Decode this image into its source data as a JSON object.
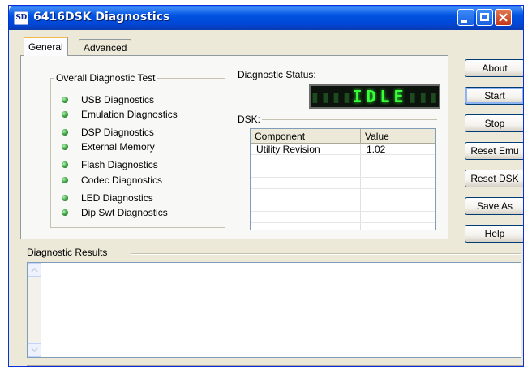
{
  "window": {
    "title": "6416DSK Diagnostics",
    "icon_text": "SD"
  },
  "tabs": [
    {
      "label": "General",
      "selected": true
    },
    {
      "label": "Advanced",
      "selected": false
    }
  ],
  "overall_test": {
    "label": "Overall Diagnostic Test",
    "items": [
      "USB Diagnostics",
      "Emulation Diagnostics",
      "DSP Diagnostics",
      "External Memory",
      "Flash Diagnostics",
      "Codec Diagnostics",
      "LED Diagnostics",
      "Dip Swt Diagnostics"
    ]
  },
  "status": {
    "label": "Diagnostic Status:",
    "display_text": "IDLE",
    "led_color": "#39ff3a"
  },
  "dsk": {
    "label": "DSK:",
    "columns": [
      "Component",
      "Value"
    ],
    "rows": [
      [
        "Utility Revision",
        "1.02"
      ],
      [
        "",
        ""
      ],
      [
        "",
        ""
      ],
      [
        "",
        ""
      ],
      [
        "",
        ""
      ],
      [
        "",
        ""
      ],
      [
        "",
        ""
      ]
    ]
  },
  "buttons": {
    "about": "About",
    "start": "Start",
    "stop": "Stop",
    "reset_emu": "Reset Emu",
    "reset_dsk": "Reset DSK",
    "save_as": "Save As",
    "help": "Help"
  },
  "results": {
    "label": "Diagnostic Results",
    "text": ""
  },
  "icons": {
    "led": "led-indicator-icon",
    "scroll_up": "scroll-up-arrow-icon",
    "scroll_down": "scroll-down-arrow-icon"
  }
}
